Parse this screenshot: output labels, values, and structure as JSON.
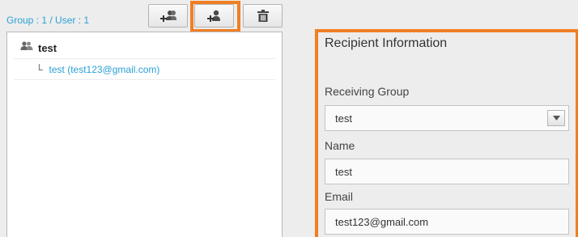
{
  "summary": "Group : 1 / User : 1",
  "toolbar": {
    "add_group_icon": "add-group-icon",
    "add_user_icon": "add-user-icon",
    "delete_icon": "trash-icon"
  },
  "tree": {
    "group_label": "test",
    "branch_glyph": "└",
    "user_label": "test (test123@gmail.com)"
  },
  "recipient": {
    "title": "Recipient Information",
    "receiving_group_label": "Receiving Group",
    "receiving_group_value": "test",
    "name_label": "Name",
    "name_value": "test",
    "email_label": "Email",
    "email_value": "test123@gmail.com"
  },
  "colors": {
    "accent_link": "#2a9fd6",
    "highlight": "#f07f24"
  }
}
